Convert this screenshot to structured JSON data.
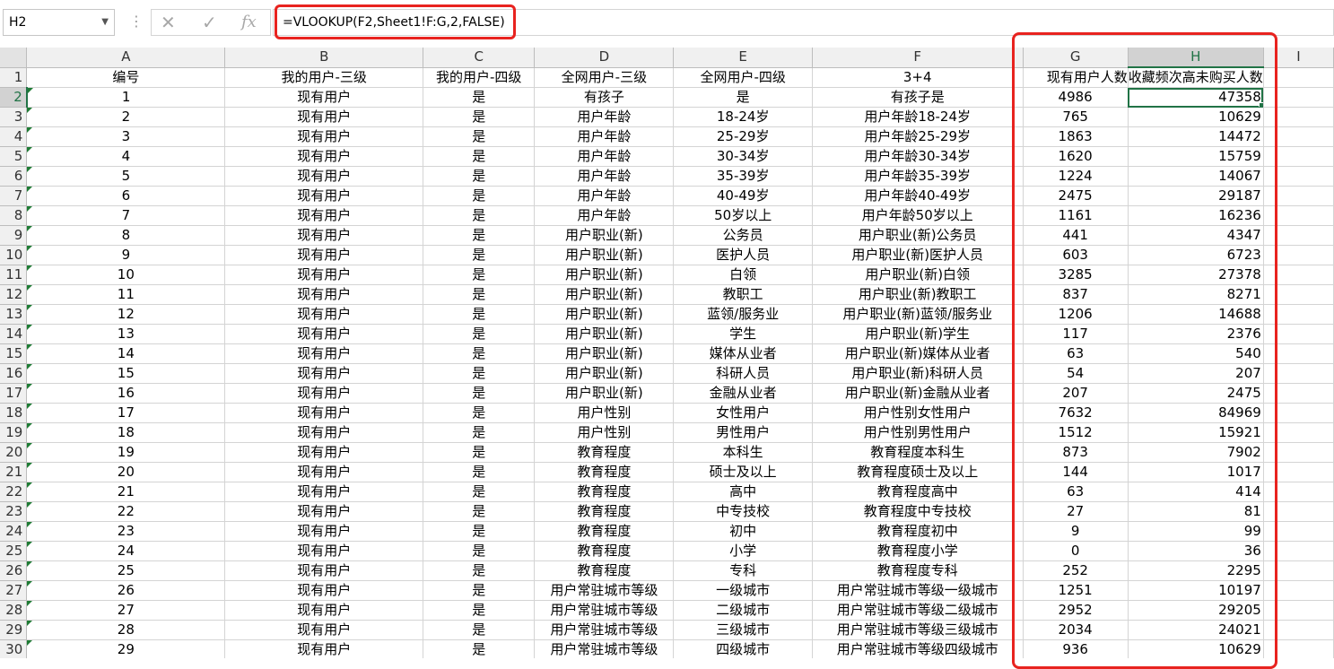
{
  "formula_bar": {
    "name_box": "H2",
    "formula": "=VLOOKUP(F2,Sheet1!F:G,2,FALSE)",
    "cancel_icon": "✕",
    "enter_icon": "✓",
    "function_icon": "fx"
  },
  "columns": [
    "A",
    "B",
    "C",
    "D",
    "E",
    "F",
    "G",
    "H",
    "I"
  ],
  "header_row": {
    "row_num": "1",
    "cells": [
      "编号",
      "我的用户-三级",
      "我的用户-四级",
      "全网用户-三级",
      "全网用户-四级",
      "3+4",
      "现有用户人数",
      "收藏频次高未购买人数",
      ""
    ]
  },
  "rows": [
    {
      "row_num": "2",
      "cells": [
        "1",
        "现有用户",
        "是",
        "有孩子",
        "是",
        "有孩子是",
        "4986",
        "47358"
      ]
    },
    {
      "row_num": "3",
      "cells": [
        "2",
        "现有用户",
        "是",
        "用户年龄",
        "18-24岁",
        "用户年龄18-24岁",
        "765",
        "10629"
      ]
    },
    {
      "row_num": "4",
      "cells": [
        "3",
        "现有用户",
        "是",
        "用户年龄",
        "25-29岁",
        "用户年龄25-29岁",
        "1863",
        "14472"
      ]
    },
    {
      "row_num": "5",
      "cells": [
        "4",
        "现有用户",
        "是",
        "用户年龄",
        "30-34岁",
        "用户年龄30-34岁",
        "1620",
        "15759"
      ]
    },
    {
      "row_num": "6",
      "cells": [
        "5",
        "现有用户",
        "是",
        "用户年龄",
        "35-39岁",
        "用户年龄35-39岁",
        "1224",
        "14067"
      ]
    },
    {
      "row_num": "7",
      "cells": [
        "6",
        "现有用户",
        "是",
        "用户年龄",
        "40-49岁",
        "用户年龄40-49岁",
        "2475",
        "29187"
      ]
    },
    {
      "row_num": "8",
      "cells": [
        "7",
        "现有用户",
        "是",
        "用户年龄",
        "50岁以上",
        "用户年龄50岁以上",
        "1161",
        "16236"
      ]
    },
    {
      "row_num": "9",
      "cells": [
        "8",
        "现有用户",
        "是",
        "用户职业(新)",
        "公务员",
        "用户职业(新)公务员",
        "441",
        "4347"
      ]
    },
    {
      "row_num": "10",
      "cells": [
        "9",
        "现有用户",
        "是",
        "用户职业(新)",
        "医护人员",
        "用户职业(新)医护人员",
        "603",
        "6723"
      ]
    },
    {
      "row_num": "11",
      "cells": [
        "10",
        "现有用户",
        "是",
        "用户职业(新)",
        "白领",
        "用户职业(新)白领",
        "3285",
        "27378"
      ]
    },
    {
      "row_num": "12",
      "cells": [
        "11",
        "现有用户",
        "是",
        "用户职业(新)",
        "教职工",
        "用户职业(新)教职工",
        "837",
        "8271"
      ]
    },
    {
      "row_num": "13",
      "cells": [
        "12",
        "现有用户",
        "是",
        "用户职业(新)",
        "蓝领/服务业",
        "用户职业(新)蓝领/服务业",
        "1206",
        "14688"
      ]
    },
    {
      "row_num": "14",
      "cells": [
        "13",
        "现有用户",
        "是",
        "用户职业(新)",
        "学生",
        "用户职业(新)学生",
        "117",
        "2376"
      ]
    },
    {
      "row_num": "15",
      "cells": [
        "14",
        "现有用户",
        "是",
        "用户职业(新)",
        "媒体从业者",
        "用户职业(新)媒体从业者",
        "63",
        "540"
      ]
    },
    {
      "row_num": "16",
      "cells": [
        "15",
        "现有用户",
        "是",
        "用户职业(新)",
        "科研人员",
        "用户职业(新)科研人员",
        "54",
        "207"
      ]
    },
    {
      "row_num": "17",
      "cells": [
        "16",
        "现有用户",
        "是",
        "用户职业(新)",
        "金融从业者",
        "用户职业(新)金融从业者",
        "207",
        "2475"
      ]
    },
    {
      "row_num": "18",
      "cells": [
        "17",
        "现有用户",
        "是",
        "用户性别",
        "女性用户",
        "用户性别女性用户",
        "7632",
        "84969"
      ]
    },
    {
      "row_num": "19",
      "cells": [
        "18",
        "现有用户",
        "是",
        "用户性别",
        "男性用户",
        "用户性别男性用户",
        "1512",
        "15921"
      ]
    },
    {
      "row_num": "20",
      "cells": [
        "19",
        "现有用户",
        "是",
        "教育程度",
        "本科生",
        "教育程度本科生",
        "873",
        "7902"
      ]
    },
    {
      "row_num": "21",
      "cells": [
        "20",
        "现有用户",
        "是",
        "教育程度",
        "硕士及以上",
        "教育程度硕士及以上",
        "144",
        "1017"
      ]
    },
    {
      "row_num": "22",
      "cells": [
        "21",
        "现有用户",
        "是",
        "教育程度",
        "高中",
        "教育程度高中",
        "63",
        "414"
      ]
    },
    {
      "row_num": "23",
      "cells": [
        "22",
        "现有用户",
        "是",
        "教育程度",
        "中专技校",
        "教育程度中专技校",
        "27",
        "81"
      ]
    },
    {
      "row_num": "24",
      "cells": [
        "23",
        "现有用户",
        "是",
        "教育程度",
        "初中",
        "教育程度初中",
        "9",
        "99"
      ]
    },
    {
      "row_num": "25",
      "cells": [
        "24",
        "现有用户",
        "是",
        "教育程度",
        "小学",
        "教育程度小学",
        "0",
        "36"
      ]
    },
    {
      "row_num": "26",
      "cells": [
        "25",
        "现有用户",
        "是",
        "教育程度",
        "专科",
        "教育程度专科",
        "252",
        "2295"
      ]
    },
    {
      "row_num": "27",
      "cells": [
        "26",
        "现有用户",
        "是",
        "用户常驻城市等级",
        "一级城市",
        "用户常驻城市等级一级城市",
        "1251",
        "10197"
      ]
    },
    {
      "row_num": "28",
      "cells": [
        "27",
        "现有用户",
        "是",
        "用户常驻城市等级",
        "二级城市",
        "用户常驻城市等级二级城市",
        "2952",
        "29205"
      ]
    },
    {
      "row_num": "29",
      "cells": [
        "28",
        "现有用户",
        "是",
        "用户常驻城市等级",
        "三级城市",
        "用户常驻城市等级三级城市",
        "2034",
        "24021"
      ]
    },
    {
      "row_num": "30",
      "cells": [
        "29",
        "现有用户",
        "是",
        "用户常驻城市等级",
        "四级城市",
        "用户常驻城市等级四级城市",
        "936",
        "10629"
      ]
    }
  ],
  "colors": {
    "highlight": "#e8231f",
    "excel_green": "#217346"
  }
}
